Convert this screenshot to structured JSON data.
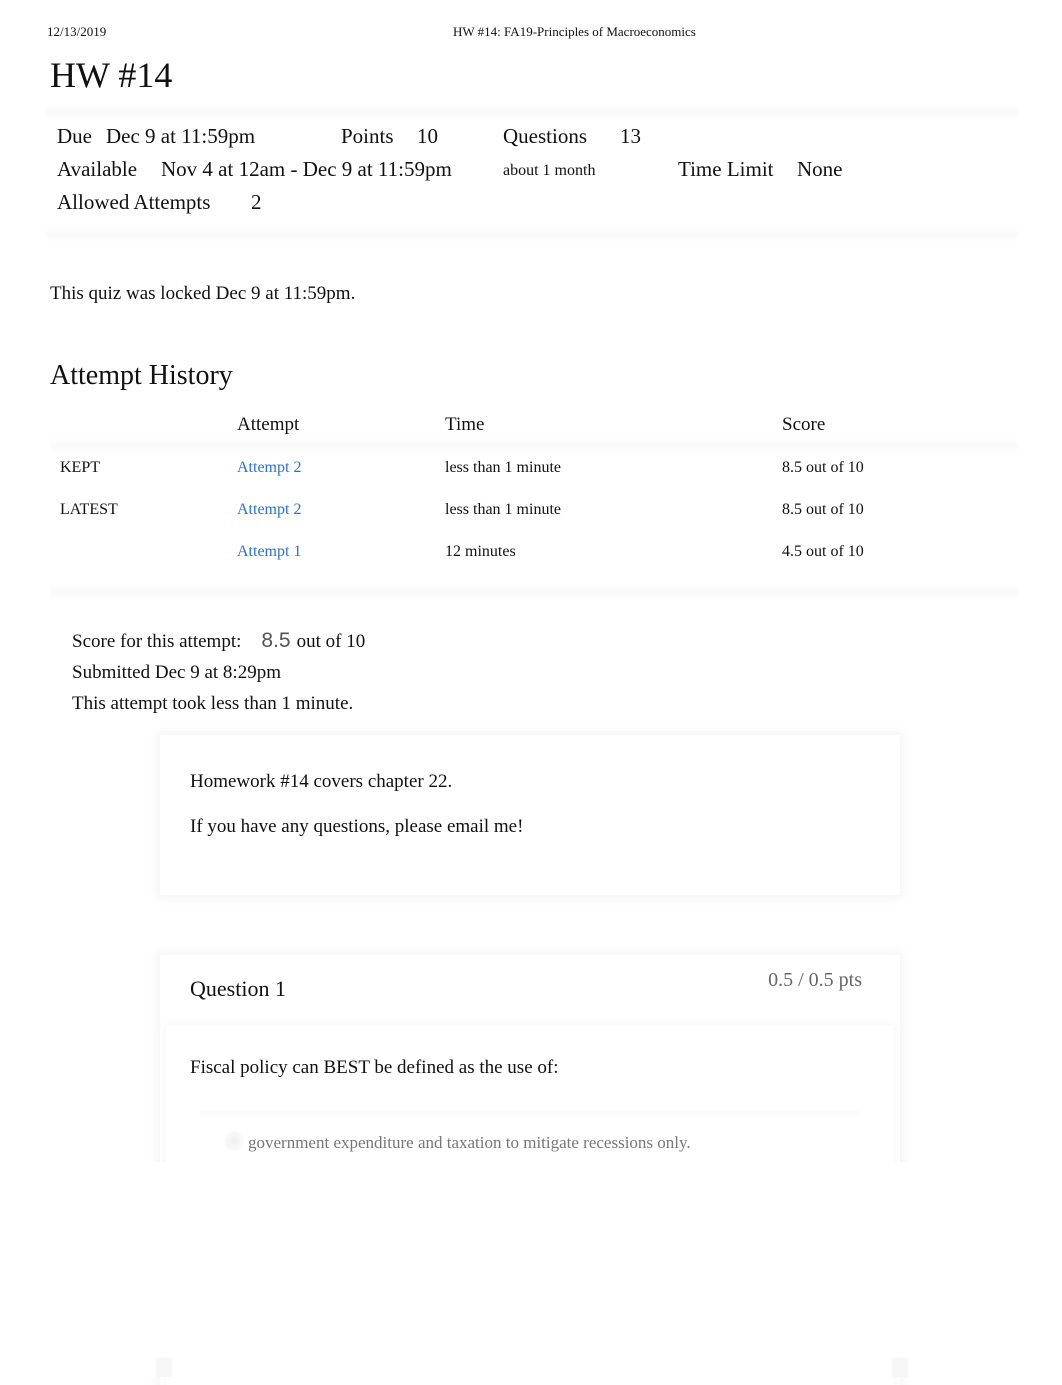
{
  "print_header": {
    "date": "12/13/2019",
    "title": "HW #14: FA19-Principles of Macroeconomics"
  },
  "page_title": "HW #14",
  "details": {
    "due_label": "Due",
    "due_value": "Dec 9 at 11:59pm",
    "points_label": "Points",
    "points_value": "10",
    "questions_label": "Questions",
    "questions_value": "13",
    "available_label": "Available",
    "available_value": "Nov 4 at 12am - Dec 9 at 11:59pm",
    "available_duration": "about 1 month",
    "time_limit_label": "Time Limit",
    "time_limit_value": "None",
    "allowed_attempts_label": "Allowed Attempts",
    "allowed_attempts_value": "2"
  },
  "locked_notice": "This quiz was locked Dec 9 at 11:59pm.",
  "attempt_history": {
    "title": "Attempt History",
    "headers": [
      "",
      "Attempt",
      "Time",
      "Score"
    ],
    "rows": [
      {
        "status": "KEPT",
        "attempt": "Attempt 2",
        "time": "less than 1 minute",
        "score": "8.5 out of 10"
      },
      {
        "status": "LATEST",
        "attempt": "Attempt 2",
        "time": "less than 1 minute",
        "score": "8.5 out of 10"
      },
      {
        "status": "",
        "attempt": "Attempt 1",
        "time": "12 minutes",
        "score": "4.5 out of 10"
      }
    ]
  },
  "current_attempt": {
    "score_label": "Score for this attempt:",
    "score_value": "8.5",
    "score_total": "out of 10",
    "submitted": "Submitted Dec 9 at 8:29pm",
    "duration": "This attempt took less than 1 minute."
  },
  "intro": {
    "line1": "Homework #14 covers chapter 22.",
    "line2": "If you have any questions, please email me!"
  },
  "questions": [
    {
      "title": "Question 1",
      "points": "0.5 / 0.5 pts",
      "text": "Fiscal policy can BEST be defined as the use of:",
      "answers": [
        "government expenditure and taxation to mitigate recessions only."
      ]
    }
  ],
  "colors": {
    "link": "#2d6fd6",
    "muted_text": "#777777"
  }
}
